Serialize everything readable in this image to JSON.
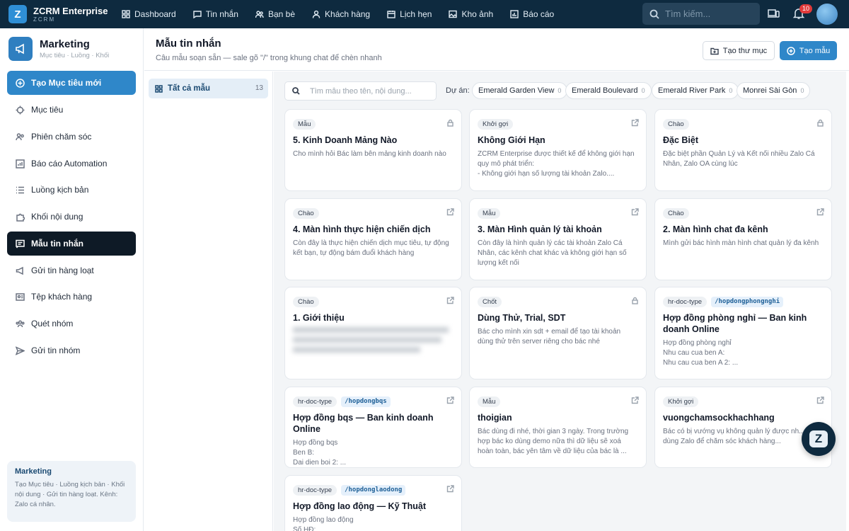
{
  "app": {
    "name": "ZCRM Enterprise",
    "sub": "ZCRM",
    "logo_letter": "Z"
  },
  "topnav": [
    {
      "label": "Dashboard",
      "icon": "grid-icon"
    },
    {
      "label": "Tin nhắn",
      "icon": "chat-icon"
    },
    {
      "label": "Bạn bè",
      "icon": "users-icon"
    },
    {
      "label": "Khách hàng",
      "icon": "user-icon"
    },
    {
      "label": "Lịch hẹn",
      "icon": "calendar-icon"
    },
    {
      "label": "Kho ảnh",
      "icon": "image-icon"
    },
    {
      "label": "Báo cáo",
      "icon": "chart-icon"
    }
  ],
  "search_top": {
    "placeholder": "Tìm kiếm..."
  },
  "notifications": {
    "count": "10"
  },
  "sidebar": {
    "title": "Marketing",
    "subtitle": "Mục tiêu · Luồng · Khối",
    "items": [
      {
        "label": "Tạo Mục tiêu mới",
        "icon": "plus-circle-icon"
      },
      {
        "label": "Mục tiêu",
        "icon": "target-icon"
      },
      {
        "label": "Phiên chăm sóc",
        "icon": "people-icon"
      },
      {
        "label": "Báo cáo Automation",
        "icon": "report-icon"
      },
      {
        "label": "Luồng kịch bản",
        "icon": "list-icon"
      },
      {
        "label": "Khối nội dung",
        "icon": "puzzle-icon"
      },
      {
        "label": "Mẫu tin nhắn",
        "icon": "message-icon"
      },
      {
        "label": "Gửi tin hàng loạt",
        "icon": "megaphone-icon"
      },
      {
        "label": "Tệp khách hàng",
        "icon": "contacts-icon"
      },
      {
        "label": "Quét nhóm",
        "icon": "group-icon"
      },
      {
        "label": "Gửi tin nhóm",
        "icon": "send-icon"
      }
    ],
    "note": {
      "title": "Marketing",
      "text": "Tạo Mục tiêu · Luồng kịch bản · Khối nội dung · Gửi tin hàng loạt. Kênh: Zalo cá nhân."
    }
  },
  "page": {
    "title": "Mẫu tin nhắn",
    "subtitle": "Câu mẫu soạn sẵn — sale gõ \"/\" trong khung chat để chèn nhanh",
    "btn_folder": "Tạo thư mục",
    "btn_create": "Tạo mẫu"
  },
  "folders": [
    {
      "label": "Tất cả mẫu",
      "count": "13"
    }
  ],
  "filters": {
    "search_placeholder": "Tìm mẫu theo tên, nội dung...",
    "label": "Dự án:",
    "chips": [
      {
        "label": "Emerald Garden View",
        "count": "0"
      },
      {
        "label": "Emerald Boulevard",
        "count": "0"
      },
      {
        "label": "Emerald River Park",
        "count": "0"
      },
      {
        "label": "Monrei Sài Gòn",
        "count": "0"
      }
    ]
  },
  "cards": [
    {
      "tag": "Mẫu",
      "slug": "",
      "icon": "lock-icon",
      "title": "5. Kinh Doanh Mảng Nào",
      "body": "Cho mình hỏi Bác làm bên mảng kinh doanh nào",
      "blur": false
    },
    {
      "tag": "Khởi gợi",
      "slug": "",
      "icon": "share-icon",
      "title": "Không Giới Hạn",
      "body": "ZCRM Enterprise được thiết kế để không giới hạn quy mô phát triển:\n- Không giới hạn số lượng tài khoản Zalo....",
      "blur": false
    },
    {
      "tag": "Chào",
      "slug": "",
      "icon": "lock-icon",
      "title": "Đặc Biệt",
      "body": "Đặc biệt phần Quản Lý và Kết nối nhiều Zalo Cá Nhân, Zalo OA cùng lúc",
      "blur": false
    },
    {
      "tag": "Chào",
      "slug": "",
      "icon": "share-icon",
      "title": "4. Màn hình thực hiện chiến dịch",
      "body": "Còn đây là thực hiện chiến dịch mục tiêu, tự động kết bạn, tự động bám đuổi khách hàng",
      "blur": false
    },
    {
      "tag": "Mẫu",
      "slug": "",
      "icon": "share-icon",
      "title": "3. Màn Hình quản lý tài khoản",
      "body": "Còn đây là hình quản lý các tài khoản Zalo Cá Nhân, các kênh chat khác và không giới hạn số lượng kết nối",
      "blur": false
    },
    {
      "tag": "Chào",
      "slug": "",
      "icon": "share-icon",
      "title": "2. Màn hình chat đa kênh",
      "body": "Mình gửi bác hình màn hình chat quản lý đa kênh",
      "blur": false
    },
    {
      "tag": "Chào",
      "slug": "",
      "icon": "share-icon",
      "title": "1. Giới thiệu",
      "body": "",
      "blur": true
    },
    {
      "tag": "Chốt",
      "slug": "",
      "icon": "lock-icon",
      "title": "Dùng Thử, Trial, SDT",
      "body": "Bác cho mình xin sdt + email để tạo tài khoản dùng thử trên server riêng cho bác nhé",
      "blur": false
    },
    {
      "tag": "hr-doc-type",
      "slug": "/hopdongphongnghi",
      "icon": "share-icon",
      "title": "Hợp đồng phòng nghỉ — Ban kinh doanh Online",
      "body": "Hợp đồng phòng nghỉ\nNhu cau cua ben A:\nNhu cau cua ben A 2: ...",
      "blur": false
    },
    {
      "tag": "hr-doc-type",
      "slug": "/hopdongbqs",
      "icon": "share-icon",
      "title": "Hợp đồng bqs — Ban kinh doanh Online",
      "body": "Hợp đồng bqs\nBen B:\nDai dien boi 2: ...",
      "blur": false
    },
    {
      "tag": "Mẫu",
      "slug": "",
      "icon": "share-icon",
      "title": "thoigian",
      "body": "Bác dùng đi nhé, thời gian 3 ngày. Trong trường hợp bác ko dùng demo nữa thì dữ liệu sẽ xoá hoàn toàn, bác yên tâm về dữ liệu của bác là ...",
      "blur": false
    },
    {
      "tag": "Khởi gợi",
      "slug": "",
      "icon": "share-icon",
      "title": "vuongchamsockhachhang",
      "body": "Bác có bị vướng vụ không quản lý được nh... viên dùng Zalo để chăm sóc khách hàng...",
      "blur": false
    },
    {
      "tag": "hr-doc-type",
      "slug": "/hopdonglaodong",
      "icon": "share-icon",
      "title": "Hợp đồng lao động — Kỹ Thuật",
      "body": "Hợp đồng lao động\nSố HĐ:",
      "blur": false
    }
  ]
}
